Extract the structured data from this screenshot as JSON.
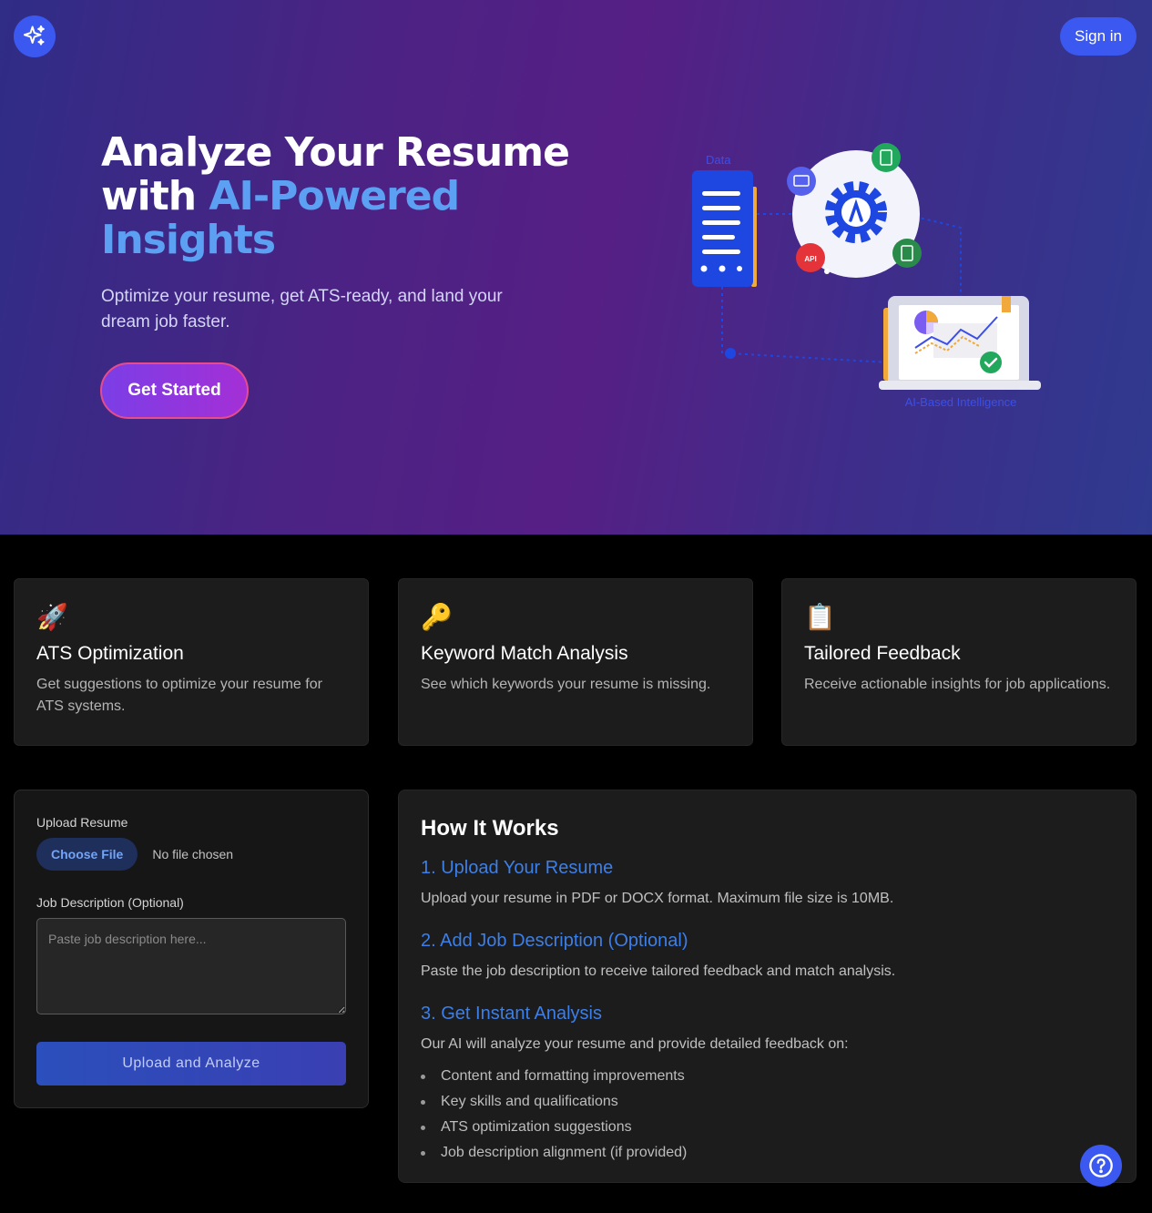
{
  "header": {
    "logo_icon": "sparkles-icon",
    "signin_label": "Sign in"
  },
  "hero": {
    "title_line1": "Analyze Your Resume",
    "title_with": "with ",
    "title_accent1": "AI-Powered",
    "title_accent2": "Insights",
    "subtitle": "Optimize your resume, get ATS-ready, and land your dream job faster.",
    "cta_label": "Get Started",
    "illustration": {
      "data_label": "Data",
      "ai_label": "AI-Based Intelligence",
      "api_label": "API"
    }
  },
  "features": [
    {
      "icon": "🚀",
      "title": "ATS Optimization",
      "desc": "Get suggestions to optimize your resume for ATS systems."
    },
    {
      "icon": "🔑",
      "title": "Keyword Match Analysis",
      "desc": "See which keywords your resume is missing."
    },
    {
      "icon": "📋",
      "title": "Tailored Feedback",
      "desc": "Receive actionable insights for job applications."
    }
  ],
  "upload": {
    "resume_label": "Upload Resume",
    "choose_file_label": "Choose File",
    "no_file_text": "No file chosen",
    "jd_label": "Job Description (Optional)",
    "jd_placeholder": "Paste job description here...",
    "submit_label": "Upload and Analyze"
  },
  "how": {
    "title": "How It Works",
    "steps": [
      {
        "title": "1. Upload Your Resume",
        "desc": "Upload your resume in PDF or DOCX format. Maximum file size is 10MB."
      },
      {
        "title": "2. Add Job Description (Optional)",
        "desc": "Paste the job description to receive tailored feedback and match analysis."
      },
      {
        "title": "3. Get Instant Analysis",
        "desc": "Our AI will analyze your resume and provide detailed feedback on:"
      }
    ],
    "bullets": [
      "Content and formatting improvements",
      "Key skills and qualifications",
      "ATS optimization suggestions",
      "Job description alignment (if provided)"
    ]
  },
  "help_icon": "question-circle-icon",
  "colors": {
    "accent_blue": "#3b59f0",
    "step_title": "#3c7fe8",
    "hero_accent": "#5ba0f2"
  }
}
